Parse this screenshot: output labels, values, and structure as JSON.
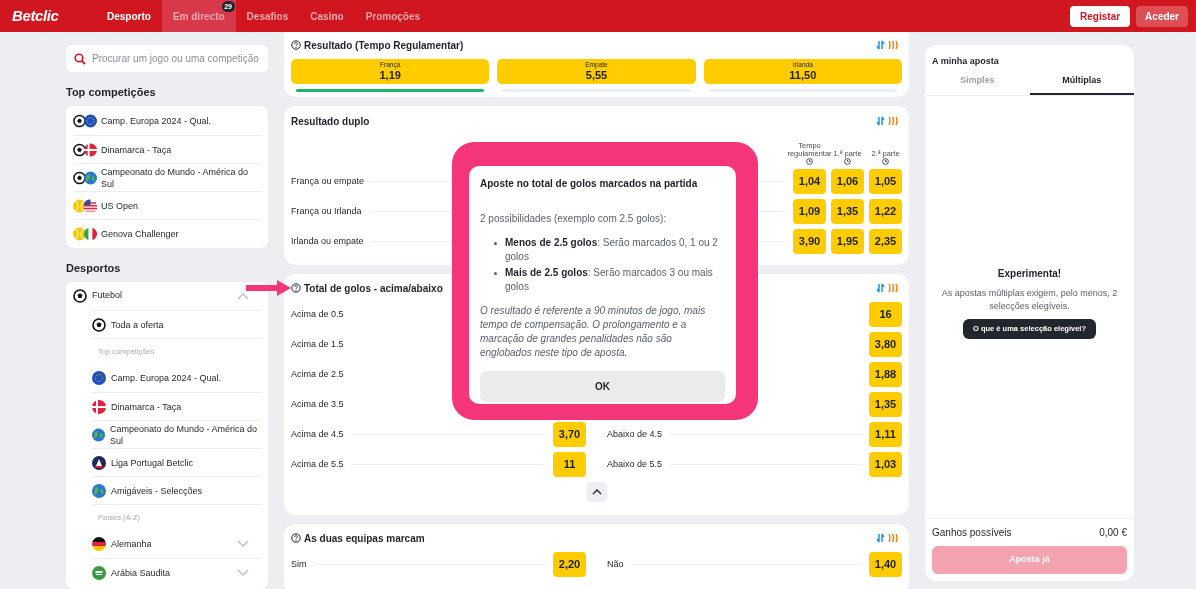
{
  "header": {
    "logo": "Betclic",
    "nav": [
      {
        "label": "Desporto",
        "selected": true,
        "highlighted": false
      },
      {
        "label": "Em directo",
        "selected": false,
        "highlighted": true,
        "badge": "29"
      },
      {
        "label": "Desafios",
        "selected": false,
        "highlighted": false
      },
      {
        "label": "Casino",
        "selected": false,
        "highlighted": false
      },
      {
        "label": "Promoções",
        "selected": false,
        "highlighted": false
      }
    ],
    "register_button": "Registar",
    "login_button": "Aceder"
  },
  "sidebar": {
    "search": {
      "placeholder": "Procurar um jogo ou uma competição"
    },
    "top_title": "Top competições",
    "top_items": [
      {
        "label": "Camp. Europa 2024 - Qual."
      },
      {
        "label": "Dinamarca - Taça"
      },
      {
        "label": "Campeonato do Mundo - América do Sul"
      },
      {
        "label": "US Open"
      },
      {
        "label": "Genova Challenger"
      }
    ],
    "sports_title": "Desportos",
    "sports": [
      {
        "label": "Futebol",
        "expanded": true,
        "children": [
          {
            "kind": "link",
            "label": "Toda a oferta"
          },
          {
            "kind": "heading",
            "label": "Top competições"
          },
          {
            "kind": "link",
            "label": "Camp. Europa 2024 - Qual."
          },
          {
            "kind": "link",
            "label": "Dinamarca - Taça"
          },
          {
            "kind": "link",
            "label": "Campeonato do Mundo - América do Sul"
          },
          {
            "kind": "link",
            "label": "Liga Portugal Betclic"
          },
          {
            "kind": "link",
            "label": "Amigáveis - Selecções"
          },
          {
            "kind": "heading",
            "label": "Países (A-Z)"
          },
          {
            "kind": "country",
            "label": "Alemanha",
            "expanded": false
          },
          {
            "kind": "country",
            "label": "Arábia Saudita",
            "expanded": false
          }
        ]
      }
    ]
  },
  "markets": [
    {
      "kind": "three_way",
      "title": "Resultado (Tempo Regulamentar)",
      "help": true,
      "outcomes": [
        {
          "label": "França",
          "odd": "1,19",
          "level": 1
        },
        {
          "label": "Empate",
          "odd": "5,55",
          "level": 0
        },
        {
          "label": "Irlanda",
          "odd": "11,50",
          "level": 0
        }
      ]
    },
    {
      "kind": "grid",
      "title": "Resultado duplo",
      "help": false,
      "columns": [
        "Tempo regulamentar",
        "1.ª parte",
        "2.ª parte"
      ],
      "rows": [
        {
          "label": "França ou empate",
          "odds": [
            "1,04",
            "1,06",
            "1,05"
          ]
        },
        {
          "label": "França ou Irlanda",
          "odds": [
            "1,09",
            "1,35",
            "1,22"
          ]
        },
        {
          "label": "Irlanda ou empate",
          "odds": [
            "3,90",
            "1,95",
            "2,35"
          ]
        }
      ]
    },
    {
      "kind": "pairs",
      "title": "Total de golos - acima/abaixo",
      "help": true,
      "collapse": true,
      "rows": [
        {
          "left": {
            "label": "Acima de 0.5"
          },
          "right": {
            "odd": "16"
          }
        },
        {
          "left": {
            "label": "Acima de 1.5"
          },
          "right": {
            "odd": "3,80"
          }
        },
        {
          "left": {
            "label": "Acima de 2.5"
          },
          "right": {
            "odd": "1,88"
          }
        },
        {
          "left": {
            "label": "Acima de 3.5"
          },
          "right": {
            "odd": "1,35"
          }
        },
        {
          "left": {
            "label": "Acima de 4.5",
            "odd": "3,70"
          },
          "right": {
            "label": "Abaixo de 4.5",
            "odd": "1,11"
          }
        },
        {
          "left": {
            "label": "Acima de 5.5",
            "odd": "11"
          },
          "right": {
            "label": "Abaixo de 5.5",
            "odd": "1,03"
          }
        }
      ]
    },
    {
      "kind": "pairs",
      "title": "As duas equipas marcam",
      "help": true,
      "collapse": false,
      "rows": [
        {
          "left": {
            "label": "Sim",
            "odd": "2,20"
          },
          "right": {
            "label": "Não",
            "odd": "1,40"
          }
        }
      ]
    }
  ],
  "modal": {
    "title": "Aposte no total de golos marcados na partida",
    "intro": "2 possibilidades (exemplo com 2.5 golos):",
    "bullets": [
      "**Menos de 2.5 golos**: Serão marcados 0, 1 ou 2 golos",
      "**Mais de 2.5 golos**: Serão marcados 3 ou mais golos"
    ],
    "note": "O resultado é referente a 90 minutos de jogo, mais tempo de compensação. O prolongamento e a marcação de grandes penalidades não são englobados neste tipo de aposta.",
    "button": "OK"
  },
  "betslip": {
    "title": "A minha aposta",
    "tabs": [
      {
        "label": "Simples",
        "selected": false
      },
      {
        "label": "Múltiplas",
        "selected": true
      }
    ],
    "empty_title": "Experimenta!",
    "empty_text": "As apostas múltiplas exigem, pelo menos, 2 selecções elegíveis.",
    "help_button": "O que é uma selecção elegível?",
    "winnings_label": "Ganhos possíveis",
    "winnings_value": "0,00 €",
    "bet_button": {
      "label": "Aposta já",
      "disabled": true
    }
  }
}
